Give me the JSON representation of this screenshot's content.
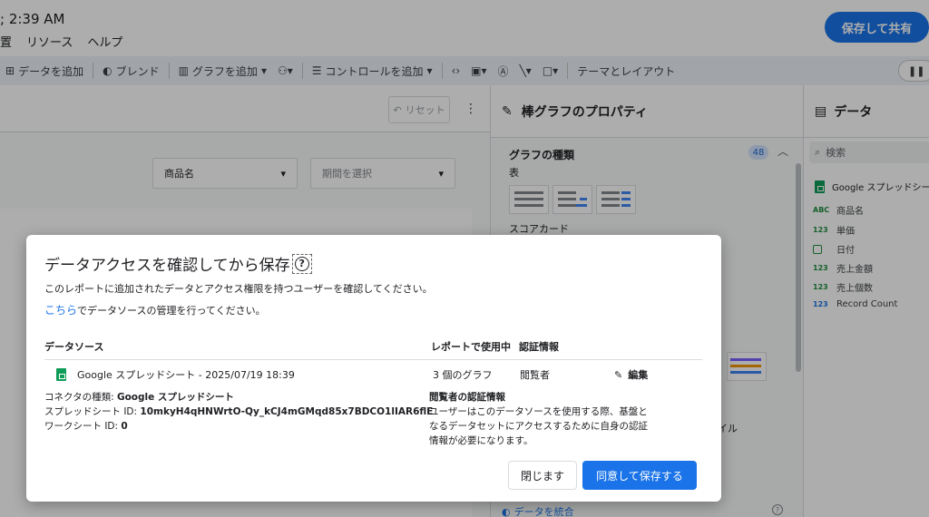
{
  "window": {
    "title": "; 2:39 AM",
    "menu": [
      "置",
      "リソース",
      "ヘルプ"
    ],
    "save_share": "保存して共有"
  },
  "toolbar": {
    "add_data": "データを追加",
    "blend": "ブレンド",
    "add_chart": "グラフを追加",
    "add_control": "コントロールを追加",
    "theme_layout": "テーマとレイアウト"
  },
  "canvas": {
    "reset_label": "リセット",
    "filters": [
      {
        "label": "商品名"
      },
      {
        "label": "期間を選択"
      }
    ]
  },
  "properties": {
    "title": "棒グラフのプロパティ",
    "chart_type_label": "グラフの種類",
    "chart_type_count": "48",
    "table_label": "表",
    "scorecard_label": "スコアカード",
    "partial_label": "イル"
  },
  "data_panel": {
    "title": "データ",
    "search_placeholder": "検索",
    "source_name": "Google スプレッドシート",
    "fields": [
      {
        "type": "ABC",
        "name": "商品名"
      },
      {
        "type": "123",
        "name": "単価"
      },
      {
        "type": "date",
        "name": "日付"
      },
      {
        "type": "123",
        "name": "売上金額"
      },
      {
        "type": "123",
        "name": "売上個数"
      },
      {
        "type": "123",
        "name": "Record Count"
      }
    ]
  },
  "bottom": {
    "blend_link": "データを統合"
  },
  "dialog": {
    "title": "データアクセスを確認してから保存",
    "description": "このレポートに追加されたデータとアクセス権限を持つユーザーを確認してください。",
    "manage_link": "こちら",
    "manage_text": "でデータソースの管理を行ってください。",
    "col_source": "データソース",
    "col_usage": "レポートで使用中",
    "col_credentials": "認証情報",
    "source_name": "Google スプレッドシート - 2025/07/19 18:39",
    "usage": "3 個のグラフ",
    "credential": "閲覧者",
    "edit": "編集",
    "connector_label": "コネクタの種類: ",
    "connector_value": "Google スプレッドシート",
    "sheet_id_label": "スプレッドシート ID: ",
    "sheet_id_value": "10mkyH4qHNWrtO-Qy_kCJ4mGMqd85x7BDCO1lIAR6flE",
    "worksheet_id_label": "ワークシート ID: ",
    "worksheet_id_value": "0",
    "cred_title": "閲覧者の認証情報",
    "cred_text": "ユーザーはこのデータソースを使用する際、基盤となるデータセットにアクセスするために自身の認証情報が必要になります。",
    "close_button": "閉じます",
    "agree_button": "同意して保存する"
  }
}
